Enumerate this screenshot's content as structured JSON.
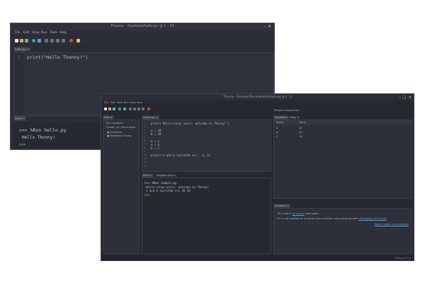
{
  "window1": {
    "title": "Thonny - /home/pi/hello.py @ 1 : 23",
    "controls": [
      "–",
      "✕"
    ],
    "menu": [
      "File",
      "Edit",
      "View",
      "Run",
      "Tools",
      "Help"
    ],
    "toolbar_icons": [
      "new-file-icon",
      "open-file-icon",
      "save-icon",
      "run-icon",
      "debug-icon",
      "step-over-icon",
      "step-into-icon",
      "step-out-icon",
      "resume-icon",
      "stop-icon",
      "zoom-icon"
    ],
    "editor_tab": "hello.py ×",
    "editor_line_number": "1",
    "editor_code": "print(\"Hello Thonny!\")",
    "shell_tab": "Shell ×",
    "shell_lines": [
      ">>> %Run hello.py",
      "Hello Thonny!",
      ">>>"
    ]
  },
  "window2": {
    "title": "Thonny - /home/pi/Documents/simple.py @ 4 : 3",
    "controls": [
      "–",
      "□",
      "✕"
    ],
    "menu": [
      "File",
      "Edit",
      "View",
      "Run",
      "Tools",
      "Help"
    ],
    "files": {
      "tab": "Files ×",
      "header": "This computer",
      "path": "/ home / pi / Documents",
      "items": [
        "simple.py",
        "Raspberry Pi.png"
      ]
    },
    "editor": {
      "tab": "simple.py ×",
      "lines": [
        {
          "no": "1",
          "code": "print('Hello Linux users, welcome to Thonny!')"
        },
        {
          "no": "2",
          "code": ""
        },
        {
          "no": "3",
          "code": "a = 10"
        },
        {
          "no": "4",
          "code": "b = 20"
        },
        {
          "no": "5",
          "code": ""
        },
        {
          "no": "6",
          "code": "a = a"
        },
        {
          "no": "7",
          "code": "a = b"
        },
        {
          "no": "8",
          "code": "b = t"
        },
        {
          "no": "9",
          "code": ""
        },
        {
          "no": "10",
          "code": "print('a and b switched >>>', a, b)"
        },
        {
          "no": "11",
          "code": ""
        },
        {
          "no": "12",
          "code": ""
        },
        {
          "no": "13",
          "code": ""
        }
      ]
    },
    "shell": {
      "tabs": [
        "Shell ×",
        "Program tree ×"
      ],
      "lines": [
        ">>> %Run simple.py",
        "Hello Linux users, welcome to Thonny!",
        "a and b switched >>> 20 10",
        ">>>"
      ]
    },
    "program_arguments": "Program arguments:",
    "variables": {
      "tabs": [
        "Variables ×",
        "Heap ×"
      ],
      "headers": [
        "Name",
        "Value"
      ],
      "rows": [
        [
          "a",
          "20"
        ],
        [
          "b",
          "10"
        ],
        [
          "t",
          "10"
        ]
      ]
    },
    "assistant": {
      "tab": "Assistant ×",
      "line1_pre": "The code in ",
      "line1_link": "simple.py",
      "line1_post": " looks good.",
      "line2_pre": "If it is not working as it should, then consider using some general ",
      "line2_link": "debugging techniques",
      "line2_post": ".",
      "footer_link": "Was it helpful or confusing?"
    },
    "status": "Python 3.7.3"
  },
  "colors": {
    "run": "#3cb371",
    "stop": "#e0443b",
    "debug": "#5aa0e0",
    "folder": "#d8b24a",
    "accent": "#9adf7a"
  }
}
